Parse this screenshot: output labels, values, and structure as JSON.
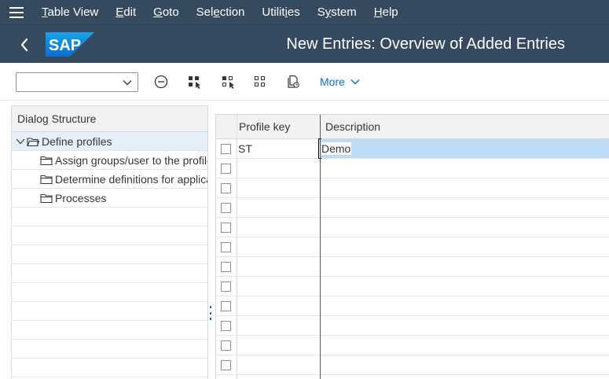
{
  "menubar": {
    "items": [
      {
        "pre": "",
        "ul": "T",
        "post": "able View"
      },
      {
        "pre": "",
        "ul": "E",
        "post": "dit"
      },
      {
        "pre": "",
        "ul": "G",
        "post": "oto"
      },
      {
        "pre": "Sel",
        "ul": "e",
        "post": "ction"
      },
      {
        "pre": "Utilit",
        "ul": "i",
        "post": "es"
      },
      {
        "pre": "S",
        "ul": "y",
        "post": "stem"
      },
      {
        "pre": "",
        "ul": "H",
        "post": "elp"
      }
    ]
  },
  "shell": {
    "logo_text": "SAP",
    "title": "New Entries: Overview of Added Entries",
    "colors": {
      "header_bg": "#354a5f",
      "logo_blue": "#0a6ed1"
    }
  },
  "toolbar": {
    "select_value": "",
    "more_label": "More",
    "icons": [
      "minus-circle-icon",
      "select-all-icon",
      "deselect-all-icon",
      "select-block-icon",
      "copy-document-icon"
    ]
  },
  "dialog_structure": {
    "header": "Dialog Structure",
    "items": [
      {
        "label": "Define profiles",
        "level": 0,
        "expanded": true,
        "selected": true
      },
      {
        "label": "Assign groups/user to the profile",
        "level": 1
      },
      {
        "label": "Determine definitions for applications",
        "level": 1
      },
      {
        "label": "Processes",
        "level": 1
      }
    ]
  },
  "table": {
    "columns": [
      "Profile key",
      "Description"
    ],
    "rows": [
      {
        "key": "ST",
        "description": "Demo"
      }
    ],
    "empty_rows": 11
  }
}
